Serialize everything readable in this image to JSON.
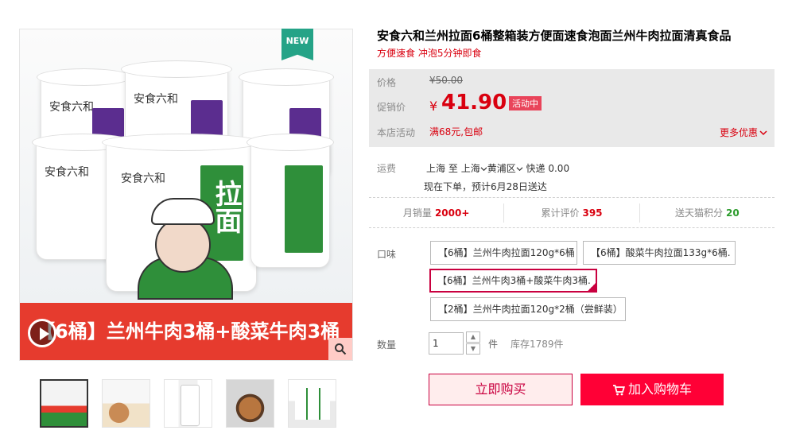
{
  "gallery": {
    "badge": "NEW",
    "banner_text": "【6桶】兰州牛肉3桶+酸菜牛肉3桶",
    "cup_brand": "安食六和",
    "cup_big_text": "拉面",
    "thumbs": [
      "thumb-1",
      "thumb-2",
      "thumb-3",
      "thumb-4",
      "thumb-5"
    ]
  },
  "product": {
    "title": "安食六和兰州拉面6桶整箱装方便面速食泡面兰州牛肉拉面清真食品",
    "subtitle": "方便速食 冲泡5分钟即食"
  },
  "price": {
    "price_label": "价格",
    "original": "¥50.00",
    "promo_label": "促销价",
    "currency": "¥",
    "promo_value": "41.90",
    "promo_tag": "活动中",
    "shop_label": "本店活动",
    "shop_activity": "满68元,包邮",
    "more_offers": "更多优惠"
  },
  "shipping": {
    "label": "运费",
    "from": "上海",
    "to_word": "至",
    "to_city": "上海",
    "to_district": "黄浦区",
    "method": "快递 0.00",
    "delivery": "现在下单，预计6月28日送达"
  },
  "stats": {
    "monthly_label": "月销量",
    "monthly_value": "2000+",
    "reviews_label": "累计评价",
    "reviews_value": "395",
    "points_label": "送天猫积分",
    "points_value": "20"
  },
  "flavor": {
    "label": "口味",
    "options": [
      "【6桶】兰州牛肉拉面120g*6桶",
      "【6桶】酸菜牛肉拉面133g*6桶.",
      "【6桶】兰州牛肉3桶+酸菜牛肉3桶.",
      "【2桶】兰州牛肉拉面120g*2桶（尝鲜装）"
    ],
    "selected_index": 2
  },
  "quantity": {
    "label": "数量",
    "value": "1",
    "up": "▲",
    "down": "▼",
    "unit": "件",
    "stock": "库存1789件"
  },
  "actions": {
    "buy_now": "立即购买",
    "add_to_cart": "加入购物车"
  },
  "colors": {
    "accent_red": "#ff0036",
    "price_red": "#d9000f",
    "banner_red": "#e63b2e",
    "brand_green": "#2f8f3a",
    "badge_green": "#25a387"
  }
}
